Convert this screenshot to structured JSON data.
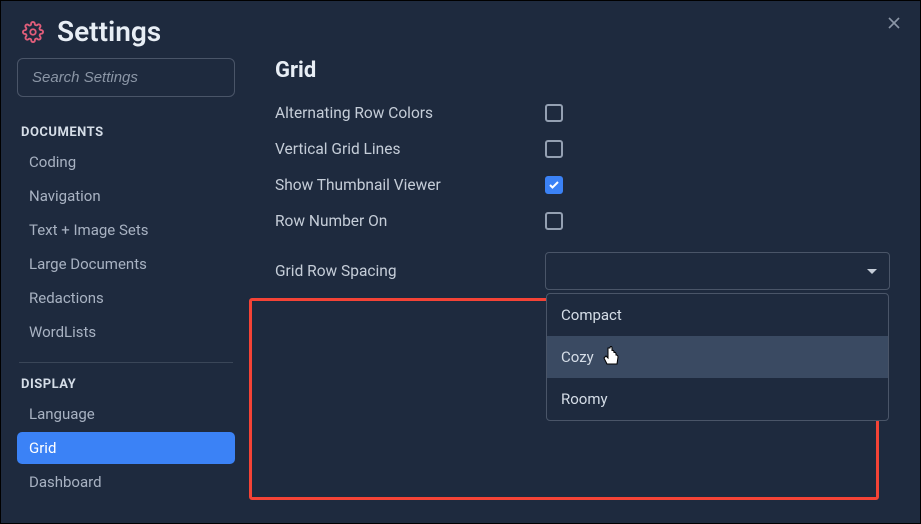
{
  "header": {
    "title": "Settings"
  },
  "search": {
    "placeholder": "Search Settings"
  },
  "sidebar": {
    "sections": [
      {
        "label": "DOCUMENTS",
        "items": [
          "Coding",
          "Navigation",
          "Text + Image Sets",
          "Large Documents",
          "Redactions",
          "WordLists"
        ]
      },
      {
        "label": "DISPLAY",
        "items": [
          "Language",
          "Grid",
          "Dashboard"
        ]
      }
    ],
    "active": "Grid"
  },
  "main": {
    "title": "Grid",
    "rows": [
      {
        "label": "Alternating Row Colors",
        "checked": false
      },
      {
        "label": "Vertical Grid Lines",
        "checked": false
      },
      {
        "label": "Show Thumbnail Viewer",
        "checked": true
      },
      {
        "label": "Row Number On",
        "checked": false
      }
    ],
    "spacing": {
      "label": "Grid Row Spacing",
      "value": "",
      "options": [
        "Compact",
        "Cozy",
        "Roomy"
      ],
      "hovered": "Cozy"
    }
  }
}
